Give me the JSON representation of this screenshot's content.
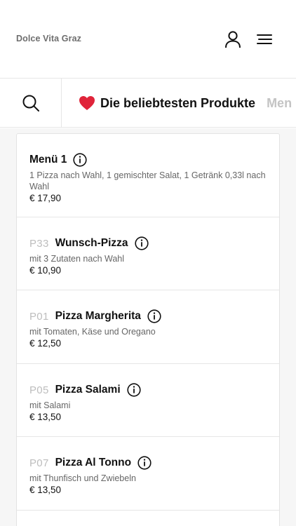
{
  "header": {
    "brand": "Dolce Vita Graz",
    "user_icon": "user-icon",
    "menu_icon": "hamburger-menu-icon"
  },
  "categories": {
    "search_icon": "search-icon",
    "active": {
      "label": "Die beliebtesten Produkte",
      "icon": "heart-icon"
    },
    "next": {
      "label": "Men"
    }
  },
  "products": [
    {
      "code": "",
      "name": "Menü 1",
      "description": "1 Pizza nach Wahl, 1 gemischter Salat, 1 Getränk 0,33l nach Wahl",
      "price": "€ 17,90"
    },
    {
      "code": "P33",
      "name": "Wunsch-Pizza",
      "description": "mit 3 Zutaten nach Wahl",
      "price": "€ 10,90"
    },
    {
      "code": "P01",
      "name": "Pizza Margherita",
      "description": "mit Tomaten, Käse und Oregano",
      "price": "€ 12,50"
    },
    {
      "code": "P05",
      "name": "Pizza Salami",
      "description": "mit Salami",
      "price": "€ 13,50"
    },
    {
      "code": "P07",
      "name": "Pizza Al Tonno",
      "description": "mit Thunfisch und Zwiebeln",
      "price": "€ 13,50"
    }
  ],
  "colors": {
    "heart": "#e0243a",
    "code": "#bdbdbd",
    "brand": "#6e6e6e"
  }
}
